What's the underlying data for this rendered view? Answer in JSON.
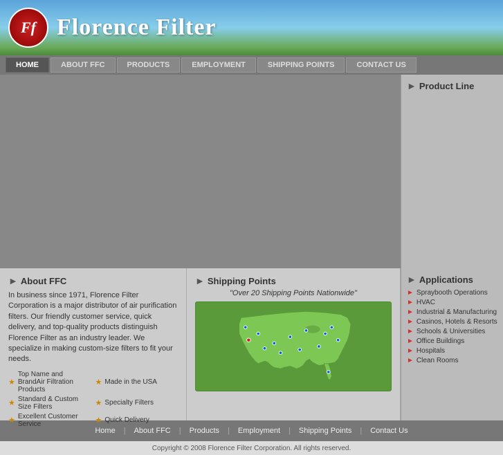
{
  "header": {
    "logo_text": "Ff",
    "site_title": "Florence Filter"
  },
  "nav": {
    "items": [
      "Home",
      "About FFC",
      "Products",
      "Employment",
      "Shipping Points",
      "Contact Us"
    ],
    "active": "Home"
  },
  "product_line": {
    "section_title": "Product Line"
  },
  "about": {
    "section_title": "About FFC",
    "description": "In business since 1971, Florence Filter Corporation is a major distributor of air purification filters. Our friendly customer service, quick delivery, and top-quality products distinguish Florence Filter as an industry leader. We specialize in making custom-size filters to fit your needs.",
    "features": [
      "Top Name and BrandAir Filtration Products",
      "Made in the USA",
      "Standard & Custom Size Filters",
      "Specialty Filters",
      "Excellent Customer Service",
      "Quick Delivery"
    ]
  },
  "shipping": {
    "section_title": "Shipping Points",
    "quote": "\"Over 20 Shipping Points Nationwide\""
  },
  "applications": {
    "section_title": "Applications",
    "items": [
      "Spraybooth Operations",
      "HVAC",
      "Industrial & Manufacturing",
      "Casinos, Hotels & Resorts",
      "Schools & Universities",
      "Office Buildings",
      "Hospitals",
      "Clean Rooms"
    ]
  },
  "footer": {
    "links": [
      "Home",
      "About FFC",
      "Products",
      "Employment",
      "Shipping Points",
      "Contact Us"
    ],
    "copyright": "Copyright © 2008 Florence Filter Corporation. All rights reserved."
  }
}
